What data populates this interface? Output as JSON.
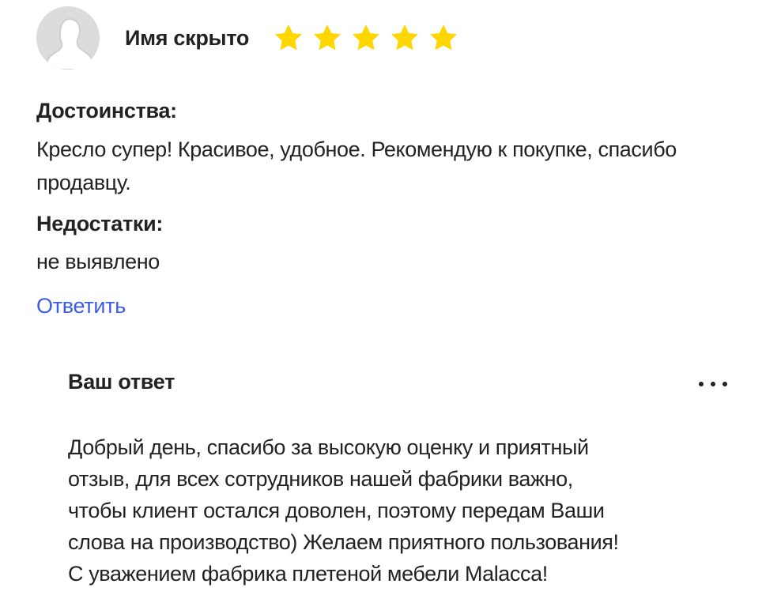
{
  "review": {
    "author": "Имя скрыто",
    "rating": 5,
    "rating_max": 5,
    "star_color": "#ffd600",
    "avatar_icon": "user-silhouette-icon",
    "pros_title": "Достоинства:",
    "pros_text": "Кресло супер! Красивое, удобное. Рекомендую к покупке, спасибо продавцу.",
    "cons_title": "Недостатки:",
    "cons_text": "не выявлено",
    "reply_label": "Ответить",
    "link_color": "#3b5ce6"
  },
  "answer": {
    "title": "Ваш ответ",
    "more_icon": "more-horizontal-icon",
    "text": "Добрый день, спасибо за высокую оценку и приятный\nотзыв, для всех сотрудников нашей фабрики важно,\nчтобы клиент остался доволен, поэтому передам Ваши\nслова на производство) Желаем приятного пользования!\nС уважением фабрика плетеной мебели Malacca!"
  }
}
